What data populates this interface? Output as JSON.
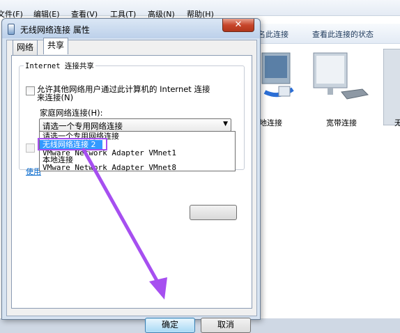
{
  "background_window": {
    "menu": [
      "文件(F)",
      "编辑(E)",
      "查看(V)",
      "工具(T)",
      "高级(N)",
      "帮助(H)"
    ],
    "commands": [
      "名此连接",
      "查看此连接的状态"
    ],
    "connections": [
      "地连接",
      "宽带连接",
      "无"
    ]
  },
  "dialog": {
    "title": "无线网络连接 属性",
    "close_label": "✕",
    "tabs": [
      "网络",
      "共享"
    ],
    "group_title": "Internet 连接共享",
    "allow_share_line1": "允许其他网络用户通过此计算机的 Internet 连接",
    "allow_share_line2": "来连接(N)",
    "home_network_label": "家庭网络连接(H):",
    "combo_value": "请选一个专用网络连接",
    "dropdown_items": [
      "请选一个专用网络连接",
      "无线网络连接 2",
      "VMware Network Adapter VMnet1",
      "本地连接",
      "VMware Network Adapter VMnet8"
    ],
    "link_text": "使用",
    "ok_label": "确定",
    "cancel_label": "取消"
  },
  "colors": {
    "arrow": "#a64ff0",
    "selected_item": "#3399ff",
    "title_bar": "#bcd0ea"
  }
}
